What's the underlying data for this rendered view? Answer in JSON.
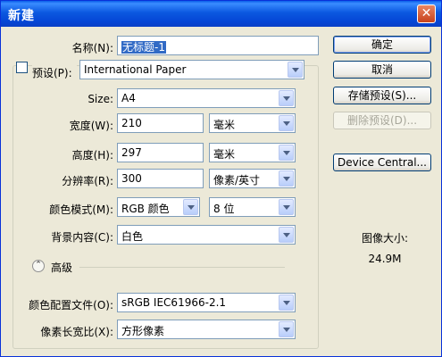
{
  "window": {
    "title": "新建",
    "close_glyph": "✕"
  },
  "fields": {
    "name": {
      "label": "名称(N):",
      "value": "无标题-1"
    },
    "preset": {
      "label": "预设(P):",
      "value": "International Paper"
    },
    "size": {
      "label": "Size:",
      "value": "A4"
    },
    "width": {
      "label": "宽度(W):",
      "value": "210",
      "unit": "毫米"
    },
    "height": {
      "label": "高度(H):",
      "value": "297",
      "unit": "毫米"
    },
    "resolution": {
      "label": "分辨率(R):",
      "value": "300",
      "unit": "像素/英寸"
    },
    "color_mode": {
      "label": "颜色模式(M):",
      "value": "RGB 颜色",
      "depth": "8 位"
    },
    "background": {
      "label": "背景内容(C):",
      "value": "白色"
    },
    "advanced": {
      "label": "高级",
      "toggle_glyph": "⌃"
    },
    "color_profile": {
      "label": "颜色配置文件(O):",
      "value": "sRGB IEC61966-2.1"
    },
    "pixel_aspect": {
      "label": "像素长宽比(X):",
      "value": "方形像素"
    }
  },
  "buttons": {
    "ok": "确定",
    "cancel": "取消",
    "save_preset": "存储预设(S)...",
    "delete_preset": "删除预设(D)...",
    "device_central": "Device Central..."
  },
  "image_size": {
    "label": "图像大小:",
    "value": "24.9M"
  }
}
